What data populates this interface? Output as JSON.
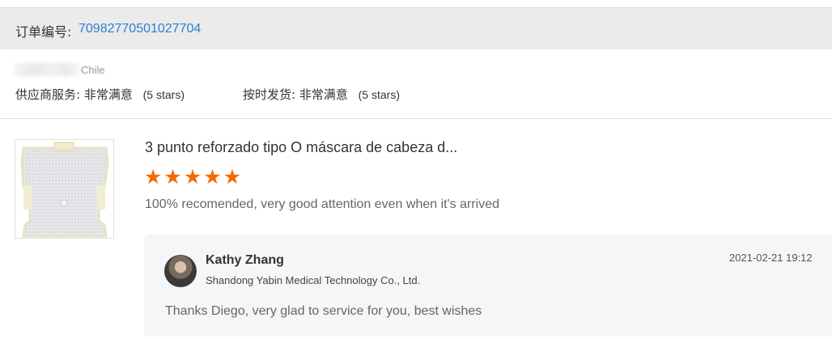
{
  "order": {
    "label": "订单编号:",
    "number": "70982770501027704"
  },
  "buyer": {
    "country": "Chile"
  },
  "ratings": [
    {
      "label": "供应商服务:",
      "value": "非常满意",
      "stars_text": "(5 stars)"
    },
    {
      "label": "按时发货:",
      "value": "非常满意",
      "stars_text": "(5 stars)"
    }
  ],
  "product": {
    "title": "3 punto reforzado tipo O máscara de cabeza d...",
    "thumbnail_icon": "thermoplastic-mask-image",
    "rating": 5,
    "rating_max": 5,
    "star_color": "#f56a00",
    "review": "100% recomended, very good attention even when it's arrived"
  },
  "reply": {
    "name": "Kathy Zhang",
    "company": "Shandong Yabin Medical Technology Co., Ltd.",
    "time": "2021-02-21 19:12",
    "text": "Thanks Diego, very glad to service for you, best wishes"
  },
  "colors": {
    "link": "#2a7fd4",
    "header_bg": "#ebebeb",
    "reply_bg": "#f4f6f8"
  }
}
